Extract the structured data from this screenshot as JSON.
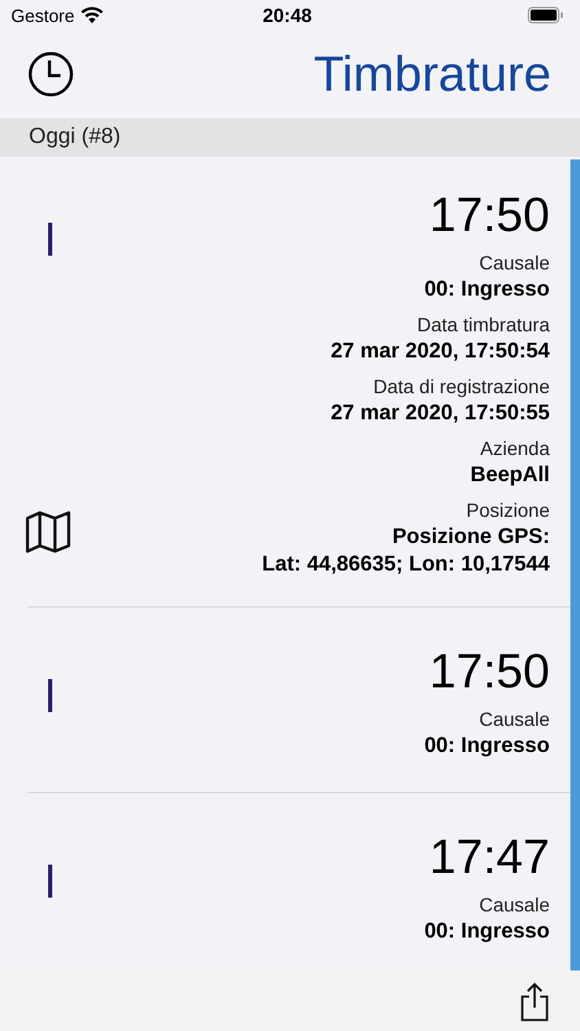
{
  "status_bar": {
    "carrier": "Gestore",
    "time": "20:48"
  },
  "nav": {
    "title": "Timbrature"
  },
  "section": {
    "title": "Oggi (#8)"
  },
  "entries": [
    {
      "time": "17:50",
      "map": true,
      "fields": [
        {
          "label": "Causale",
          "value": "00: Ingresso"
        },
        {
          "label": "Data timbratura",
          "value": "27 mar 2020, 17:50:54"
        },
        {
          "label": "Data di registrazione",
          "value": "27 mar 2020, 17:50:55"
        },
        {
          "label": "Azienda",
          "value": "BeepAll"
        },
        {
          "label": "Posizione",
          "value": "Posizione GPS:\nLat: 44,86635; Lon: 10,17544"
        }
      ]
    },
    {
      "time": "17:50",
      "map": false,
      "fields": [
        {
          "label": "Causale",
          "value": "00: Ingresso"
        }
      ]
    },
    {
      "time": "17:47",
      "map": false,
      "fields": [
        {
          "label": "Causale",
          "value": "00: Ingresso"
        }
      ]
    }
  ]
}
